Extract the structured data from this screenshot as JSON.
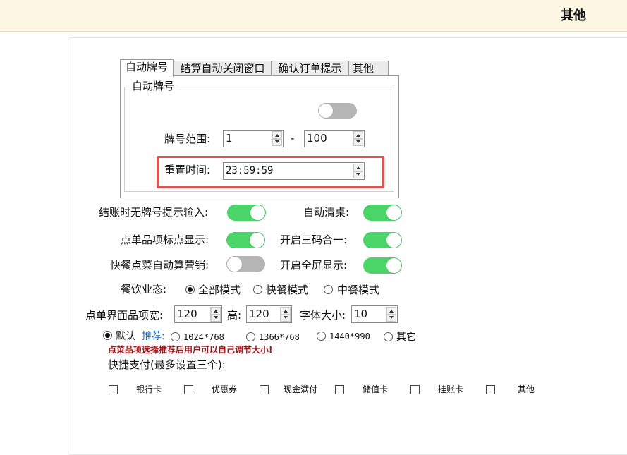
{
  "header": {
    "title": "其他"
  },
  "tabs": [
    {
      "label": "自动牌号",
      "active": true
    },
    {
      "label": "结算自动关闭窗口",
      "active": false
    },
    {
      "label": "确认订单提示",
      "active": false
    },
    {
      "label": "其他",
      "active": false
    }
  ],
  "auto_number": {
    "group_title": "自动牌号",
    "enabled": false,
    "range_label": "牌号范围:",
    "range_from": "1",
    "range_sep": "-",
    "range_to": "100",
    "reset_label": "重置时间:",
    "reset_time": "23:59:59"
  },
  "switches": {
    "no_number_prompt": {
      "label": "结账时无牌号提示输入:",
      "on": true
    },
    "auto_clear_table": {
      "label": "自动清桌:",
      "on": true
    },
    "item_mark_display": {
      "label": "点单品项标点显示:",
      "on": true
    },
    "three_in_one": {
      "label": "开启三码合一:",
      "on": true
    },
    "fast_auto_marketing": {
      "label": "快餐点菜自动算营销:",
      "on": false
    },
    "fullscreen": {
      "label": "开启全屏显示:",
      "on": true
    }
  },
  "catering": {
    "label": "餐饮业态:",
    "options": [
      "全部模式",
      "快餐模式",
      "中餐模式"
    ],
    "selected": "全部模式"
  },
  "item_size": {
    "width_label": "点单界面品项宽:",
    "width": "120",
    "height_label": "高:",
    "height": "120",
    "font_label": "字体大小:",
    "font_size": "10"
  },
  "resolution": {
    "options": [
      "默认",
      "1024*768",
      "1366*768",
      "1440*990",
      "其它"
    ],
    "selected": "默认",
    "recommend_label": "推荐:",
    "hint": "点菜品项选择推荐后用户可以自己调节大小!"
  },
  "quick_pay": {
    "label": "快捷支付(最多设置三个):",
    "items": [
      "银行卡",
      "优惠券",
      "现金满付",
      "储值卡",
      "挂账卡",
      "其他"
    ]
  },
  "colors": {
    "toggle_on": "#4bd468",
    "toggle_off": "#b5b5b5",
    "highlight": "#e05353",
    "warning": "#a0161b",
    "recommend": "#1e6fc4"
  }
}
